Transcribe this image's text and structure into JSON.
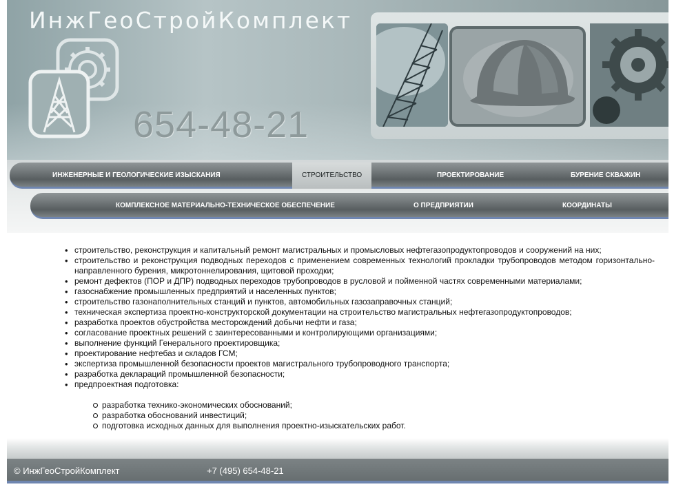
{
  "header": {
    "site_title": "ИнжГеоСтройКомплект",
    "phone_big": "654-48-21"
  },
  "nav": {
    "row1": [
      {
        "label": "ИНЖЕНЕРНЫЕ И ГЕОЛОГИЧЕСКИЕ ИЗЫСКАНИЯ",
        "active": false
      },
      {
        "label": "СТРОИТЕЛЬСТВО",
        "active": true
      },
      {
        "label": "ПРОЕКТИРОВАНИЕ",
        "active": false
      },
      {
        "label": "БУРЕНИЕ СКВАЖИН",
        "active": false
      }
    ],
    "row2": [
      {
        "label": "КОМПЛЕКСНОЕ МАТЕРИАЛЬНО-ТЕХНИЧЕСКОЕ ОБЕСПЕЧЕНИЕ",
        "active": false
      },
      {
        "label": "О ПРЕДПРИЯТИИ",
        "active": false
      },
      {
        "label": "КООРДИНАТЫ",
        "active": false
      }
    ]
  },
  "content": {
    "items": [
      "строительство, реконструкция и капитальный ремонт магистральных и промысловых нефтегазопродуктопроводов и сооружений на них;",
      "строительство и реконструкция подводных переходов с применением современных технологий прокладки трубопроводов методом горизонтально-направленного бурения, микротоннелирования, щитовой проходки;",
      "ремонт дефектов (ПОР и ДПР) подводных переходов трубопроводов в русловой и пойменной частях современными материалами;",
      "газоснабжение промышленных предприятий и населенных пунктов;",
      "строительство газонаполнительных станций и пунктов, автомобильных газозаправочных станций;",
      "техническая экспертиза проектно-конструкторской документации на строительство магистральных нефтегазопродуктопроводов;",
      "разработка проектов обустройства месторождений добычи нефти и газа;",
      "согласование проектных решений с заинтересованными и контролирующими организациями;",
      "выполнение функций Генерального проектировщика;",
      "проектирование нефтебаз и складов ГСМ;",
      "экспертиза промышленной безопасности проектов магистрального трубопроводного транспорта;",
      "разработка деклараций промышленной безопасности;",
      "предпроектная подготовка:"
    ],
    "subitems": [
      "разработка технико-экономических обоснований;",
      "разработка обоснований инвестиций;",
      "подготовка исходных данных для выполнения проектно-изыскательских работ."
    ]
  },
  "footer": {
    "copyright": "© ИнжГеоСтройКомплект",
    "phone": "+7 (495) 654-48-21"
  },
  "colors": {
    "nav_underline": "#6f86b0",
    "nav_bar": "#6c7274",
    "header_bg": "#a9b8ba"
  }
}
